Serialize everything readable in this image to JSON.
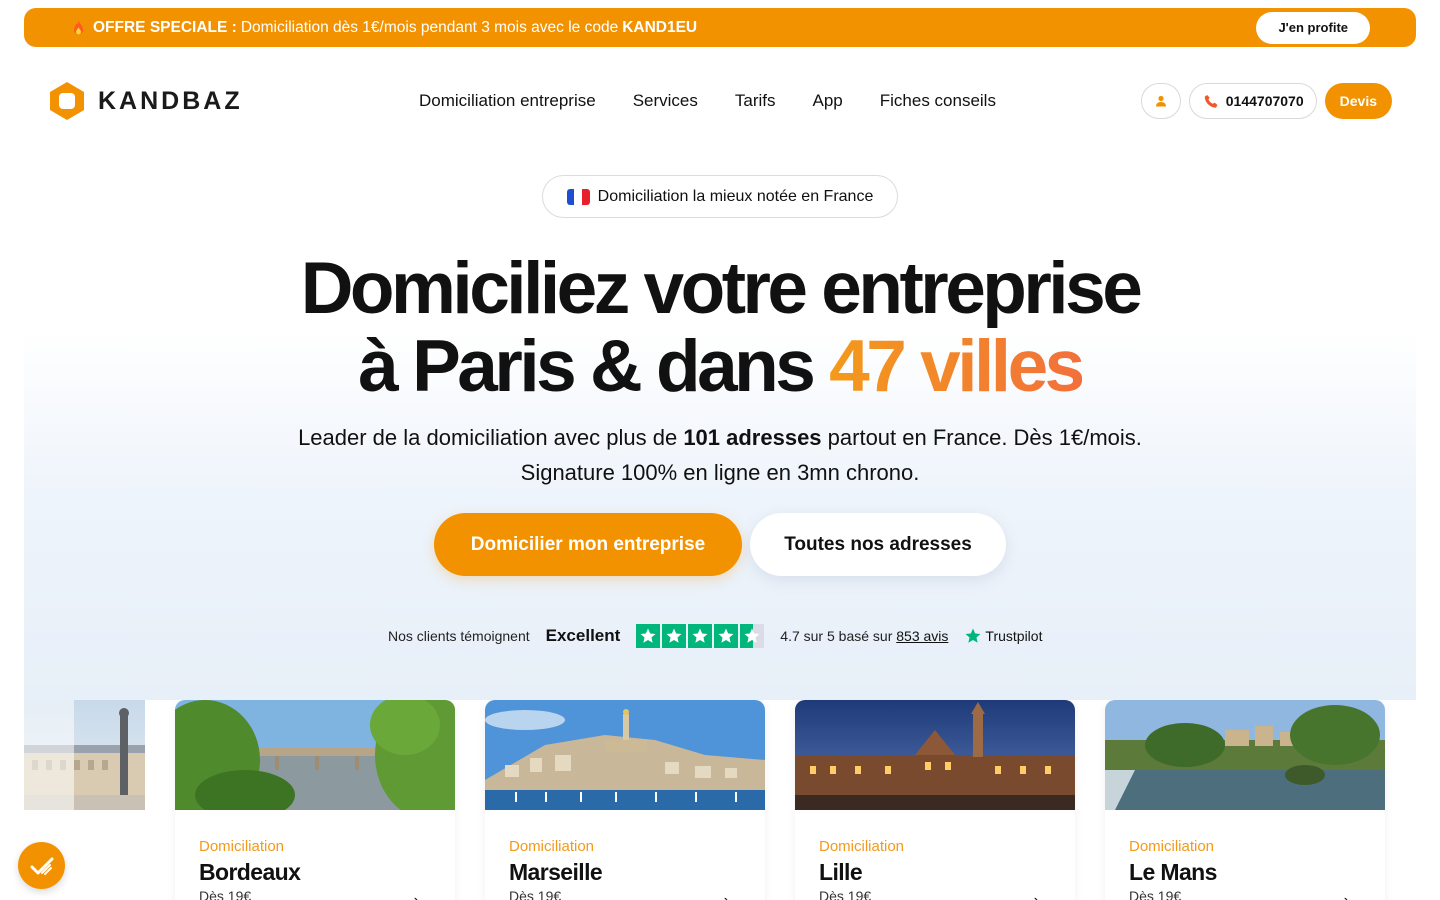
{
  "promo": {
    "text_prefix": "OFFRE SPECIALE : ",
    "text_main": "Domiciliation dès 1€/mois pendant 3 mois avec le code ",
    "code": "KAND1EU",
    "button": "J'en profite"
  },
  "brand": {
    "name": "KANDBAZ",
    "color": "#f39200"
  },
  "nav": {
    "items": [
      "Domiciliation entreprise",
      "Services",
      "Tarifs",
      "App",
      "Fiches conseils"
    ]
  },
  "actions": {
    "account_icon": "user-icon",
    "phone": "0144707070",
    "devis": "Devis"
  },
  "hero": {
    "badge": "Domiciliation la mieux notée en France",
    "headline_line1": "Domiciliez votre entreprise",
    "headline_line2_prefix": "à Paris & dans ",
    "headline_accent": "47 villes",
    "sub_line1_a": "Leader de la domiciliation avec plus de ",
    "sub_line1_bold": "101 adresses",
    "sub_line1_b": " partout en France. Dès 1€/mois.",
    "sub_line2": "Signature 100% en ligne en 3mn chrono.",
    "cta_primary": "Domicilier mon entreprise",
    "cta_secondary": "Toutes nos adresses"
  },
  "trust": {
    "intro": "Nos clients témoignent",
    "label": "Excellent",
    "rating": 4.7,
    "score_prefix": "4.7 sur 5 basé sur ",
    "reviews_link": "853 avis",
    "provider": "Trustpilot"
  },
  "cards": [
    {
      "kicker": "Domiciliation",
      "city": "Bordeaux",
      "price": "Dès 19€"
    },
    {
      "kicker": "Domiciliation",
      "city": "Marseille",
      "price": "Dès 19€"
    },
    {
      "kicker": "Domiciliation",
      "city": "Lille",
      "price": "Dès 19€"
    },
    {
      "kicker": "Domiciliation",
      "city": "Le Mans",
      "price": "Dès 19€"
    }
  ],
  "colors": {
    "accent": "#f39200",
    "trustpilot": "#00b67a"
  }
}
